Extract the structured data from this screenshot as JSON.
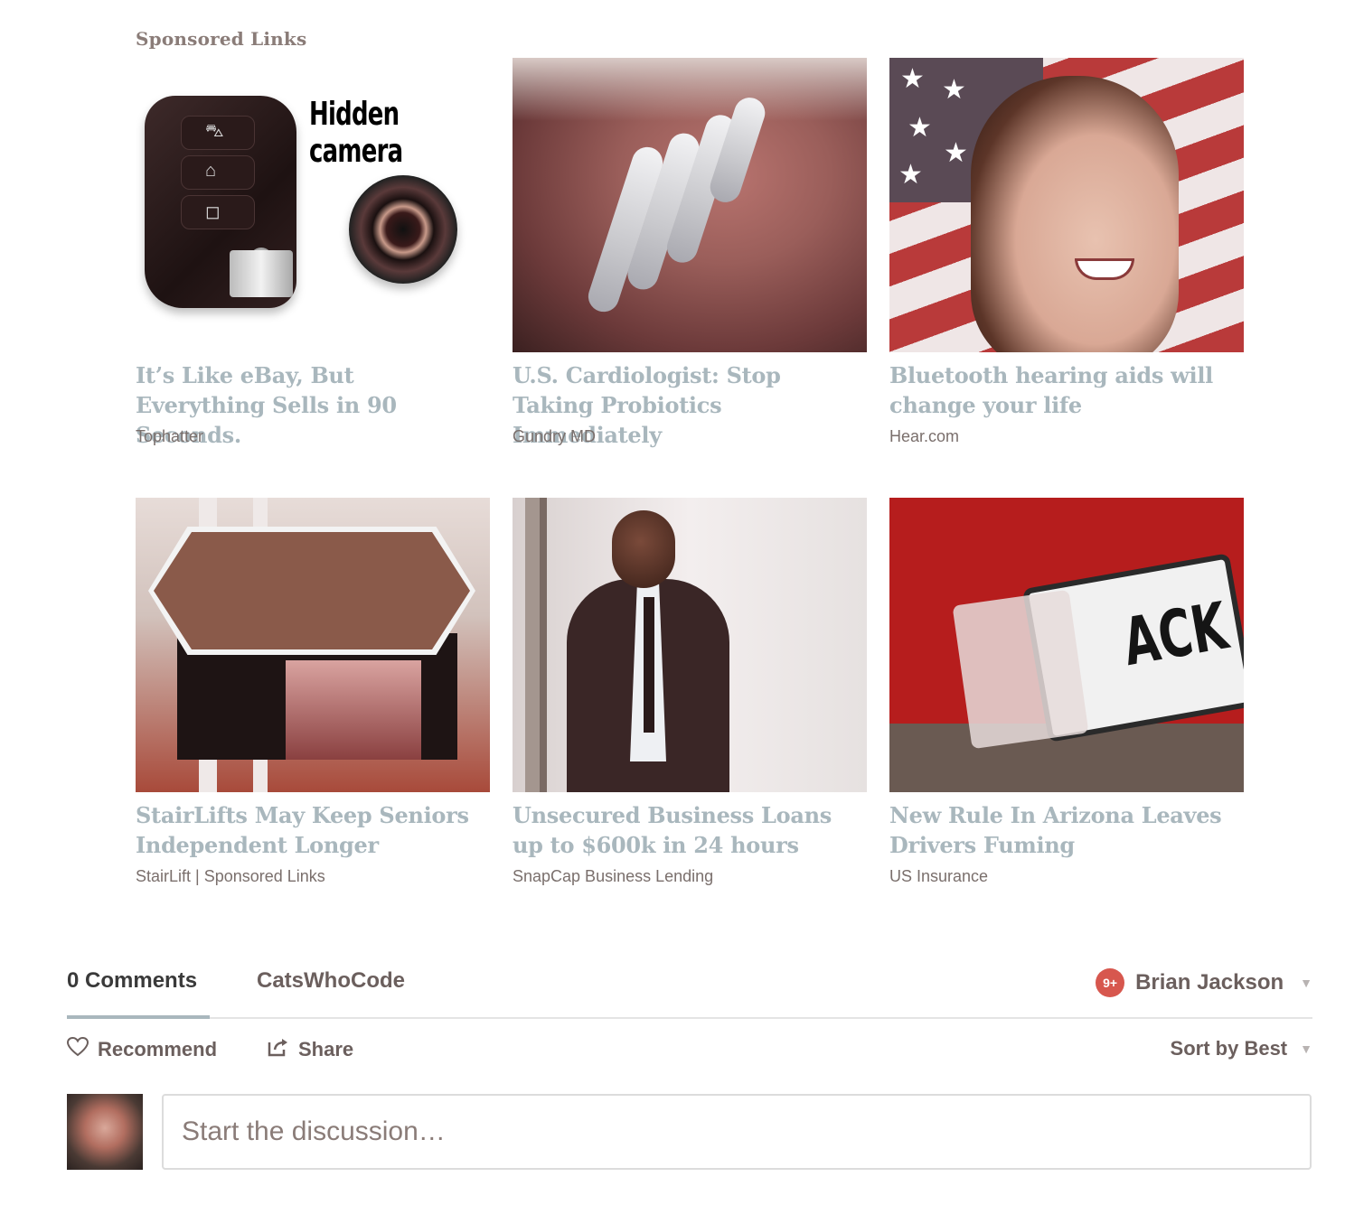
{
  "sponsored": {
    "heading": "Sponsored Links",
    "cards": [
      {
        "title": "It’s Like eBay, But Everything Sells in 90 Seconds.",
        "source": "Tophatter",
        "image_text": "Hidden camera"
      },
      {
        "title": "U.S. Cardiologist: Stop Taking Probiotics Immediately",
        "source": "Gundry MD"
      },
      {
        "title": "Bluetooth hearing aids will change your life",
        "source": "Hear.com"
      },
      {
        "title": "StairLifts May Keep Seniors Independent Longer",
        "source": "StairLift | Sponsored Links"
      },
      {
        "title": "Unsecured Business Loans up to $600k in 24 hours",
        "source": "SnapCap Business Lending"
      },
      {
        "title": "New Rule In Arizona Leaves Drivers Fuming",
        "source": "US Insurance",
        "image_text": "ACK"
      }
    ]
  },
  "comments": {
    "count_label": "0 Comments",
    "site_label": "CatsWhoCode",
    "user": {
      "name": "Brian Jackson",
      "notifications": "9+"
    },
    "recommend_label": "Recommend",
    "share_label": "Share",
    "sort_label": "Sort by Best",
    "input_placeholder": "Start the discussion…"
  },
  "colors": {
    "card_title": "#a9b7bd",
    "tab_underline": "#a9b7bd",
    "notification_badge": "#d7574e"
  },
  "icons": {
    "recommend": "heart-icon",
    "share": "share-icon",
    "dropdown": "chevron-down-icon"
  }
}
